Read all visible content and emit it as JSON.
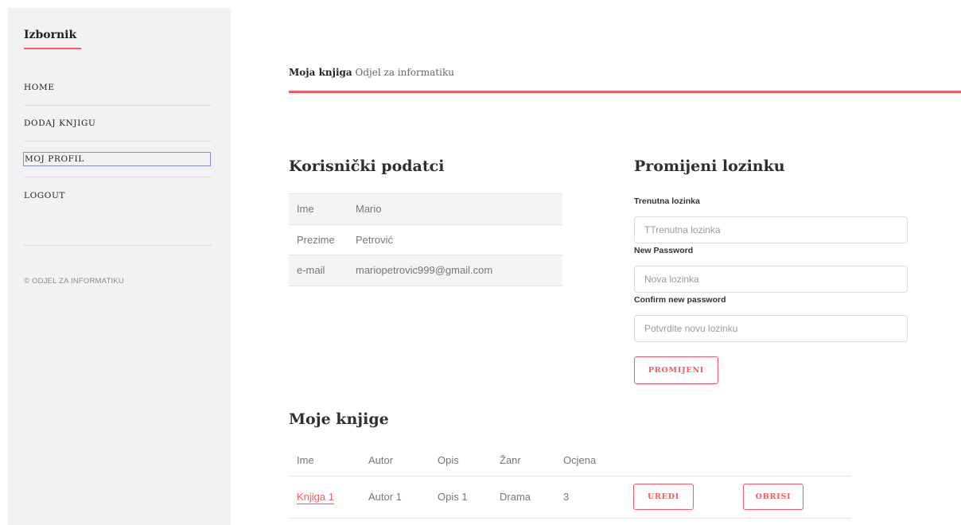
{
  "sidebar": {
    "title": "Izbornik",
    "items": [
      {
        "label": "HOME"
      },
      {
        "label": "DODAJ KNJIGU"
      },
      {
        "label": "MOJ PROFIL"
      },
      {
        "label": "LOGOUT"
      }
    ],
    "copyright": "© ODJEL ZA INFORMATIKU"
  },
  "header": {
    "brand": "Moja knjiga",
    "subtitle": "Odjel za informatiku"
  },
  "user_info": {
    "heading": "Korisnički podatci",
    "rows": [
      {
        "key": "Ime",
        "value": "Mario"
      },
      {
        "key": "Prezime",
        "value": "Petrović"
      },
      {
        "key": "e-mail",
        "value": "mariopetrovic999@gmail.com"
      }
    ]
  },
  "password_form": {
    "heading": "Promijeni lozinku",
    "current_label": "Trenutna lozinka",
    "current_placeholder": "TTrenutna lozinka",
    "new_label": "New Password",
    "new_placeholder": "Nova lozinka",
    "confirm_label": "Confirm new password",
    "confirm_placeholder": "Potvrdite novu lozinku",
    "submit_label": "PROMIJENI"
  },
  "books": {
    "heading": "Moje knjige",
    "columns": [
      "Ime",
      "Autor",
      "Opis",
      "Žanr",
      "Ocjena"
    ],
    "rows": [
      {
        "name": "Knjiga 1",
        "author": "Autor 1",
        "description": "Opis 1",
        "genre": "Drama",
        "rating": "3",
        "edit_label": "UREDI",
        "delete_label": "OBRISI"
      }
    ]
  },
  "colors": {
    "accent": "#f55a65",
    "sidebar_bg": "#f2f2f4"
  }
}
